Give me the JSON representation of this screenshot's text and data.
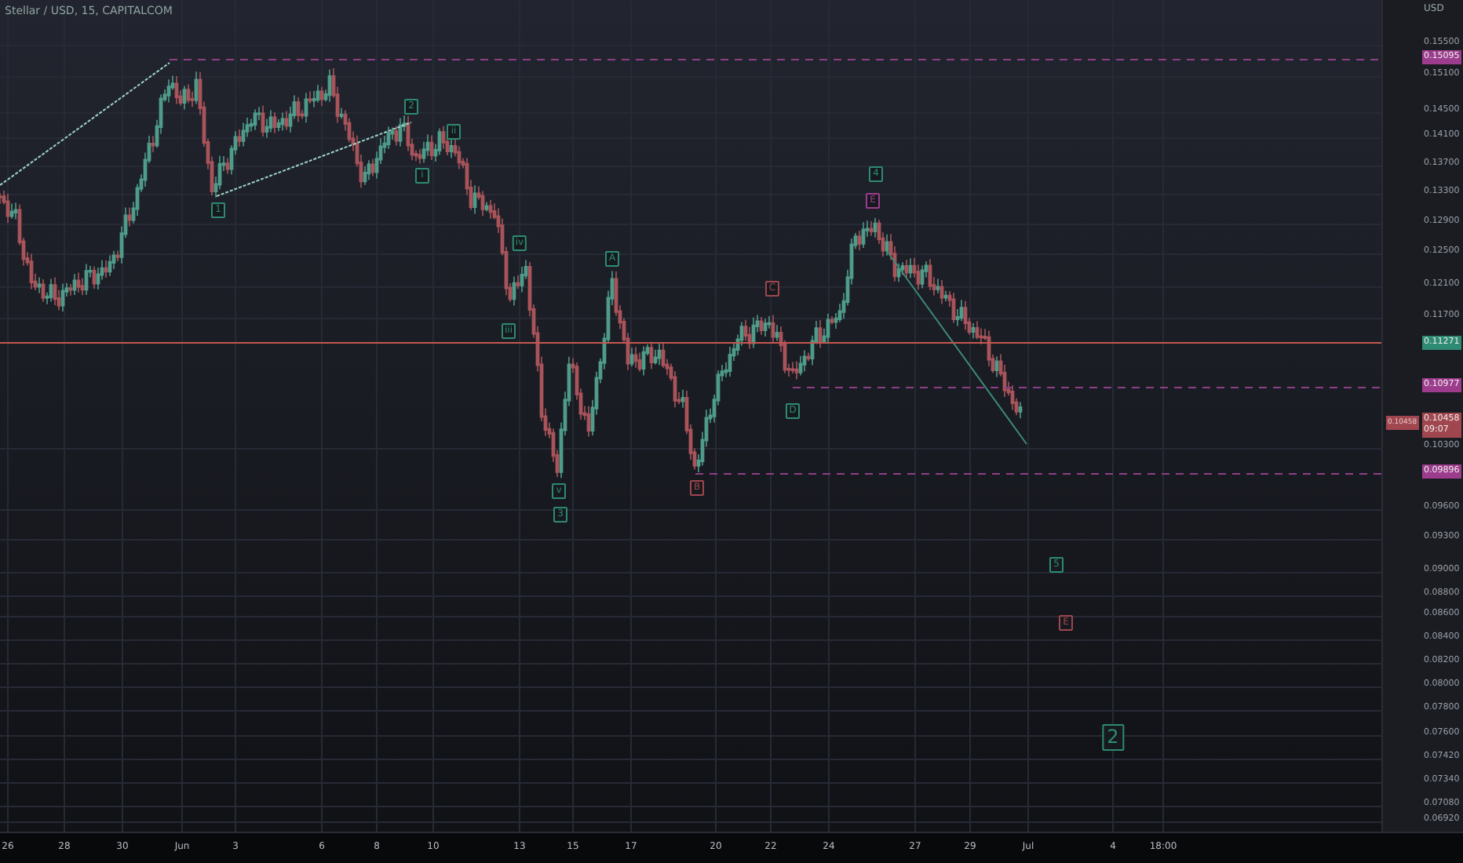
{
  "symbol_title": "Stellar / USD, 15, CAPITALCOM",
  "price_axis": {
    "currency": "USD",
    "ticks": [
      "0.15500",
      "0.15100",
      "0.14500",
      "0.14100",
      "0.13700",
      "0.13300",
      "0.12900",
      "0.12500",
      "0.12100",
      "0.11700",
      "0.10300",
      "0.09600",
      "0.09300",
      "0.09000",
      "0.08800",
      "0.08600",
      "0.08400",
      "0.08200",
      "0.08000",
      "0.07800",
      "0.07600",
      "0.07420",
      "0.07340",
      "0.07080",
      "0.06920"
    ],
    "price_labels": [
      {
        "text": "0.15095",
        "color": "#9c3c8c"
      },
      {
        "text": "0.11271",
        "color": "#2e8a72"
      },
      {
        "text": "0.10977",
        "color": "#9c3c8c"
      },
      {
        "text": "0.10458",
        "sub": "09:07",
        "color": "#a0464f"
      },
      {
        "text": "0.09896",
        "color": "#9c3c8c"
      }
    ],
    "side_label": {
      "text": "0.10458"
    }
  },
  "time_axis": [
    "26",
    "28",
    "30",
    "Jun",
    "3",
    "6",
    "8",
    "10",
    "13",
    "15",
    "17",
    "20",
    "22",
    "24",
    "27",
    "29",
    "Jul",
    "4",
    "18:00"
  ],
  "wave_labels": [
    {
      "text": "1",
      "color": "#2e8a72",
      "kind": "small"
    },
    {
      "text": "2",
      "color": "#2e8a72",
      "kind": "small"
    },
    {
      "text": "ii",
      "color": "#2e8a72",
      "kind": "small"
    },
    {
      "text": "i",
      "color": "#2e8a72",
      "kind": "small"
    },
    {
      "text": "iv",
      "color": "#2e8a72",
      "kind": "small"
    },
    {
      "text": "iii",
      "color": "#2e8a72",
      "kind": "small"
    },
    {
      "text": "A",
      "color": "#2e8a72",
      "kind": "small"
    },
    {
      "text": "v",
      "color": "#2e8a72",
      "kind": "small"
    },
    {
      "text": "3",
      "color": "#2e8a72",
      "kind": "small"
    },
    {
      "text": "C",
      "color": "#a0464f",
      "kind": "small"
    },
    {
      "text": "B",
      "color": "#a0464f",
      "kind": "small"
    },
    {
      "text": "D",
      "color": "#2e8a72",
      "kind": "small"
    },
    {
      "text": "4",
      "color": "#2e8a72",
      "kind": "small"
    },
    {
      "text": "E",
      "color": "#9c3c8c",
      "kind": "small"
    },
    {
      "text": "5",
      "color": "#2e8a72",
      "kind": "small"
    },
    {
      "text": "E",
      "color": "#a0464f",
      "kind": "small"
    },
    {
      "text": "2",
      "color": "#2e8a72",
      "kind": "large"
    }
  ]
}
